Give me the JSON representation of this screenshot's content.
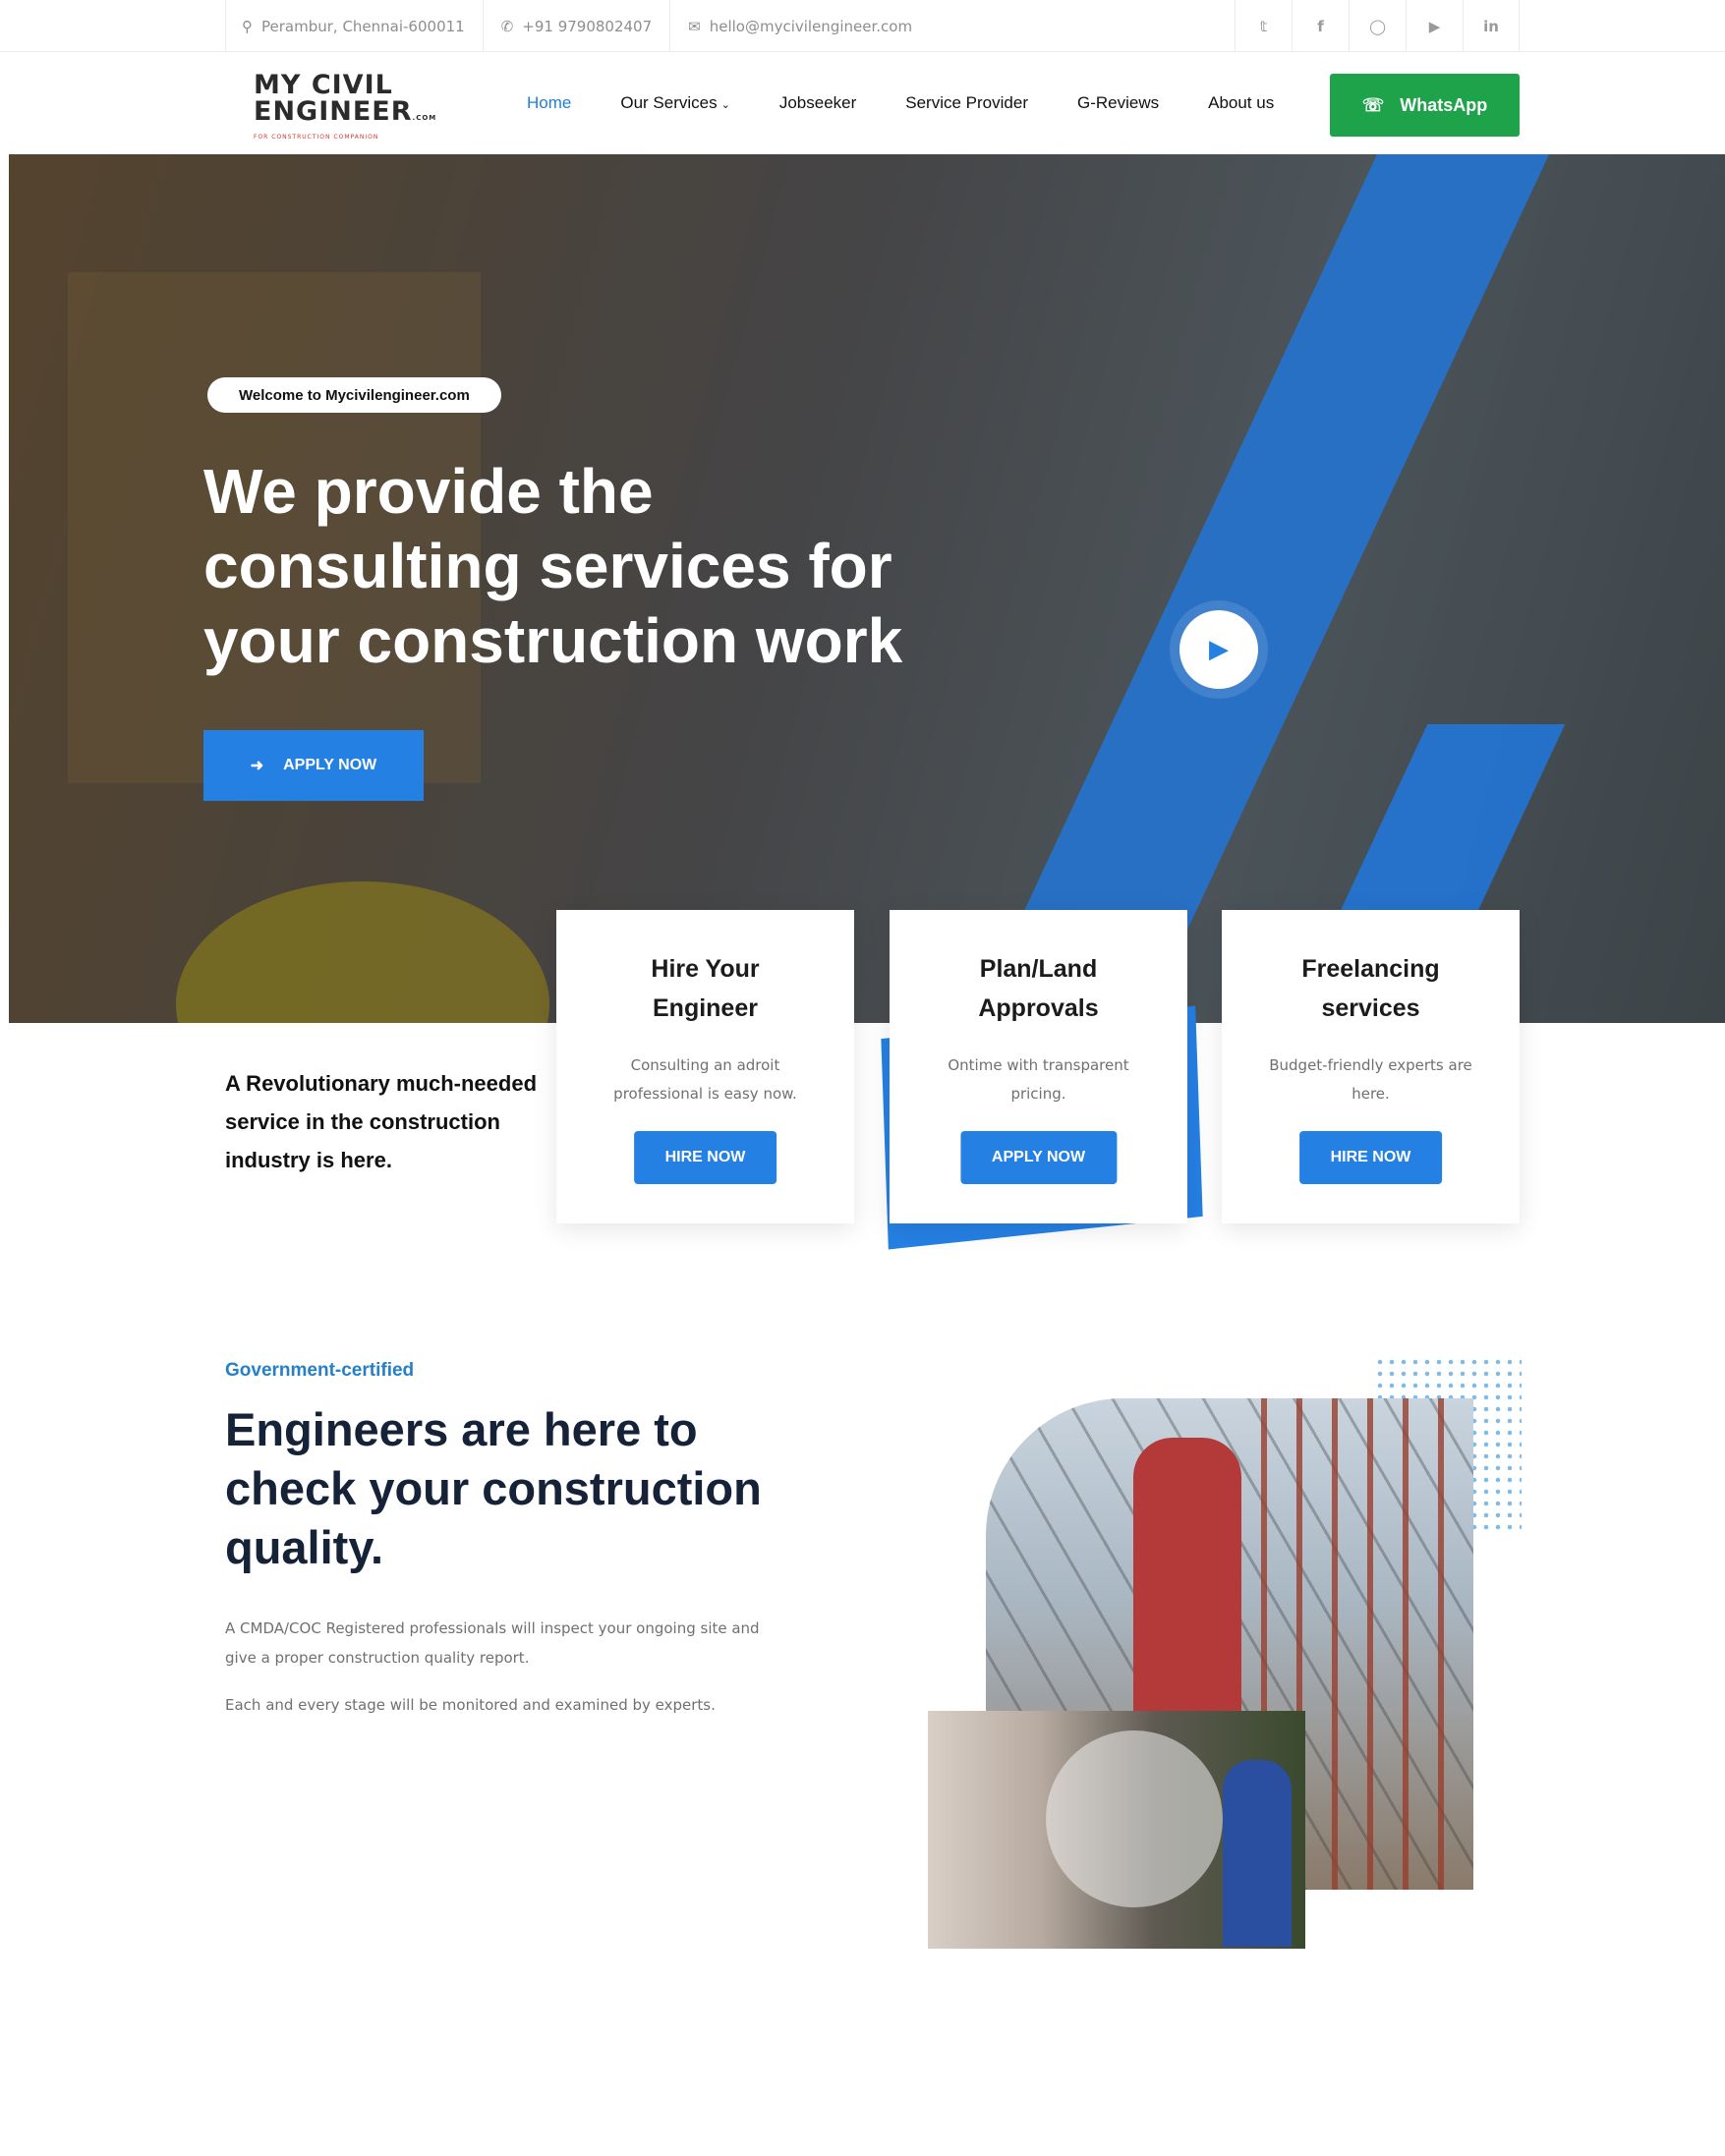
{
  "topbar": {
    "location": "Perambur, Chennai-600011",
    "phone": "+91 9790802407",
    "email": "hello@mycivilengineer.com",
    "social_icons": [
      "twitter-icon",
      "facebook-icon",
      "instagram-icon",
      "youtube-icon",
      "linkedin-icon"
    ]
  },
  "logo": {
    "line1": "MY CIVIL",
    "line2": "ENGINEER",
    "suffix": ".COM",
    "tagline": "FOR CONSTRUCTION COMPANION"
  },
  "nav": {
    "items": [
      "Home",
      "Our Services",
      "Jobseeker",
      "Service Provider",
      "G-Reviews",
      "About us"
    ],
    "active": "Home",
    "whatsapp_label": "WhatsApp"
  },
  "hero": {
    "pill": "Welcome to Mycivilengineer.com",
    "title": "We provide the consulting services for your construction work",
    "apply_label": "APPLY NOW"
  },
  "intro": "A Revolutionary much-needed service in the construction industry is here.",
  "cards": [
    {
      "title": "Hire Your Engineer",
      "text": "Consulting an adroit professional is easy now.",
      "button": "HIRE NOW"
    },
    {
      "title": "Plan/Land Approvals",
      "text": "Ontime with transparent pricing.",
      "button": "APPLY NOW"
    },
    {
      "title": "Freelancing services",
      "text": "Budget-friendly experts are here.",
      "button": "HIRE NOW"
    }
  ],
  "quality": {
    "kicker": "Government-certified",
    "title": "Engineers are here to check your construction quality.",
    "para1": "A CMDA/COC Registered professionals will inspect your ongoing site and give a proper construction quality report.",
    "para2": "Each and every stage will be monitored and examined by experts."
  },
  "colors": {
    "accent": "#2580e4",
    "whatsapp": "#1ea34a",
    "kicker": "#2580c8"
  }
}
